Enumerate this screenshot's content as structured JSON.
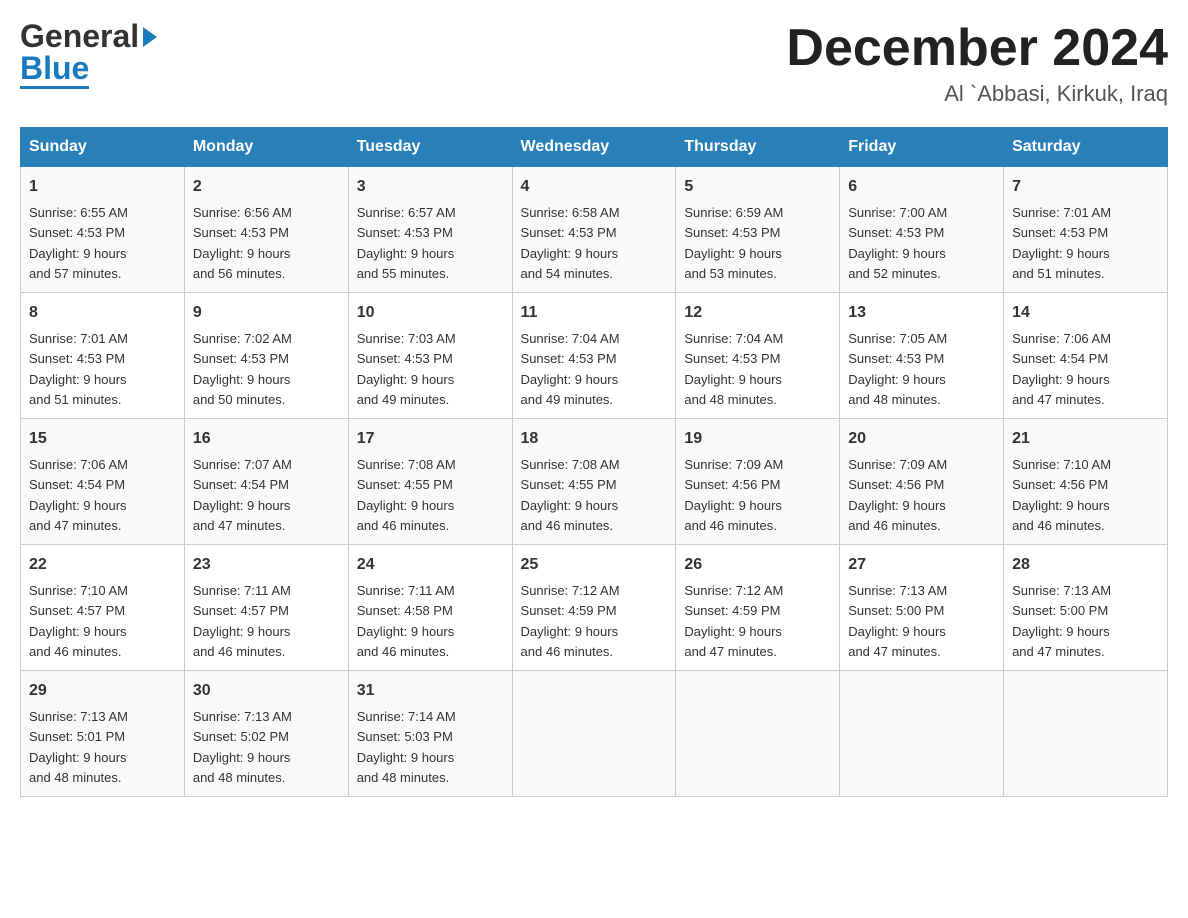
{
  "logo": {
    "general": "General",
    "blue": "Blue"
  },
  "header": {
    "month": "December 2024",
    "location": "Al `Abbasi, Kirkuk, Iraq"
  },
  "days_of_week": [
    "Sunday",
    "Monday",
    "Tuesday",
    "Wednesday",
    "Thursday",
    "Friday",
    "Saturday"
  ],
  "weeks": [
    [
      {
        "day": "1",
        "sunrise": "6:55 AM",
        "sunset": "4:53 PM",
        "daylight": "9 hours and 57 minutes."
      },
      {
        "day": "2",
        "sunrise": "6:56 AM",
        "sunset": "4:53 PM",
        "daylight": "9 hours and 56 minutes."
      },
      {
        "day": "3",
        "sunrise": "6:57 AM",
        "sunset": "4:53 PM",
        "daylight": "9 hours and 55 minutes."
      },
      {
        "day": "4",
        "sunrise": "6:58 AM",
        "sunset": "4:53 PM",
        "daylight": "9 hours and 54 minutes."
      },
      {
        "day": "5",
        "sunrise": "6:59 AM",
        "sunset": "4:53 PM",
        "daylight": "9 hours and 53 minutes."
      },
      {
        "day": "6",
        "sunrise": "7:00 AM",
        "sunset": "4:53 PM",
        "daylight": "9 hours and 52 minutes."
      },
      {
        "day": "7",
        "sunrise": "7:01 AM",
        "sunset": "4:53 PM",
        "daylight": "9 hours and 51 minutes."
      }
    ],
    [
      {
        "day": "8",
        "sunrise": "7:01 AM",
        "sunset": "4:53 PM",
        "daylight": "9 hours and 51 minutes."
      },
      {
        "day": "9",
        "sunrise": "7:02 AM",
        "sunset": "4:53 PM",
        "daylight": "9 hours and 50 minutes."
      },
      {
        "day": "10",
        "sunrise": "7:03 AM",
        "sunset": "4:53 PM",
        "daylight": "9 hours and 49 minutes."
      },
      {
        "day": "11",
        "sunrise": "7:04 AM",
        "sunset": "4:53 PM",
        "daylight": "9 hours and 49 minutes."
      },
      {
        "day": "12",
        "sunrise": "7:04 AM",
        "sunset": "4:53 PM",
        "daylight": "9 hours and 48 minutes."
      },
      {
        "day": "13",
        "sunrise": "7:05 AM",
        "sunset": "4:53 PM",
        "daylight": "9 hours and 48 minutes."
      },
      {
        "day": "14",
        "sunrise": "7:06 AM",
        "sunset": "4:54 PM",
        "daylight": "9 hours and 47 minutes."
      }
    ],
    [
      {
        "day": "15",
        "sunrise": "7:06 AM",
        "sunset": "4:54 PM",
        "daylight": "9 hours and 47 minutes."
      },
      {
        "day": "16",
        "sunrise": "7:07 AM",
        "sunset": "4:54 PM",
        "daylight": "9 hours and 47 minutes."
      },
      {
        "day": "17",
        "sunrise": "7:08 AM",
        "sunset": "4:55 PM",
        "daylight": "9 hours and 46 minutes."
      },
      {
        "day": "18",
        "sunrise": "7:08 AM",
        "sunset": "4:55 PM",
        "daylight": "9 hours and 46 minutes."
      },
      {
        "day": "19",
        "sunrise": "7:09 AM",
        "sunset": "4:56 PM",
        "daylight": "9 hours and 46 minutes."
      },
      {
        "day": "20",
        "sunrise": "7:09 AM",
        "sunset": "4:56 PM",
        "daylight": "9 hours and 46 minutes."
      },
      {
        "day": "21",
        "sunrise": "7:10 AM",
        "sunset": "4:56 PM",
        "daylight": "9 hours and 46 minutes."
      }
    ],
    [
      {
        "day": "22",
        "sunrise": "7:10 AM",
        "sunset": "4:57 PM",
        "daylight": "9 hours and 46 minutes."
      },
      {
        "day": "23",
        "sunrise": "7:11 AM",
        "sunset": "4:57 PM",
        "daylight": "9 hours and 46 minutes."
      },
      {
        "day": "24",
        "sunrise": "7:11 AM",
        "sunset": "4:58 PM",
        "daylight": "9 hours and 46 minutes."
      },
      {
        "day": "25",
        "sunrise": "7:12 AM",
        "sunset": "4:59 PM",
        "daylight": "9 hours and 46 minutes."
      },
      {
        "day": "26",
        "sunrise": "7:12 AM",
        "sunset": "4:59 PM",
        "daylight": "9 hours and 47 minutes."
      },
      {
        "day": "27",
        "sunrise": "7:13 AM",
        "sunset": "5:00 PM",
        "daylight": "9 hours and 47 minutes."
      },
      {
        "day": "28",
        "sunrise": "7:13 AM",
        "sunset": "5:00 PM",
        "daylight": "9 hours and 47 minutes."
      }
    ],
    [
      {
        "day": "29",
        "sunrise": "7:13 AM",
        "sunset": "5:01 PM",
        "daylight": "9 hours and 48 minutes."
      },
      {
        "day": "30",
        "sunrise": "7:13 AM",
        "sunset": "5:02 PM",
        "daylight": "9 hours and 48 minutes."
      },
      {
        "day": "31",
        "sunrise": "7:14 AM",
        "sunset": "5:03 PM",
        "daylight": "9 hours and 48 minutes."
      },
      null,
      null,
      null,
      null
    ]
  ],
  "labels": {
    "sunrise": "Sunrise:",
    "sunset": "Sunset:",
    "daylight": "Daylight:"
  }
}
